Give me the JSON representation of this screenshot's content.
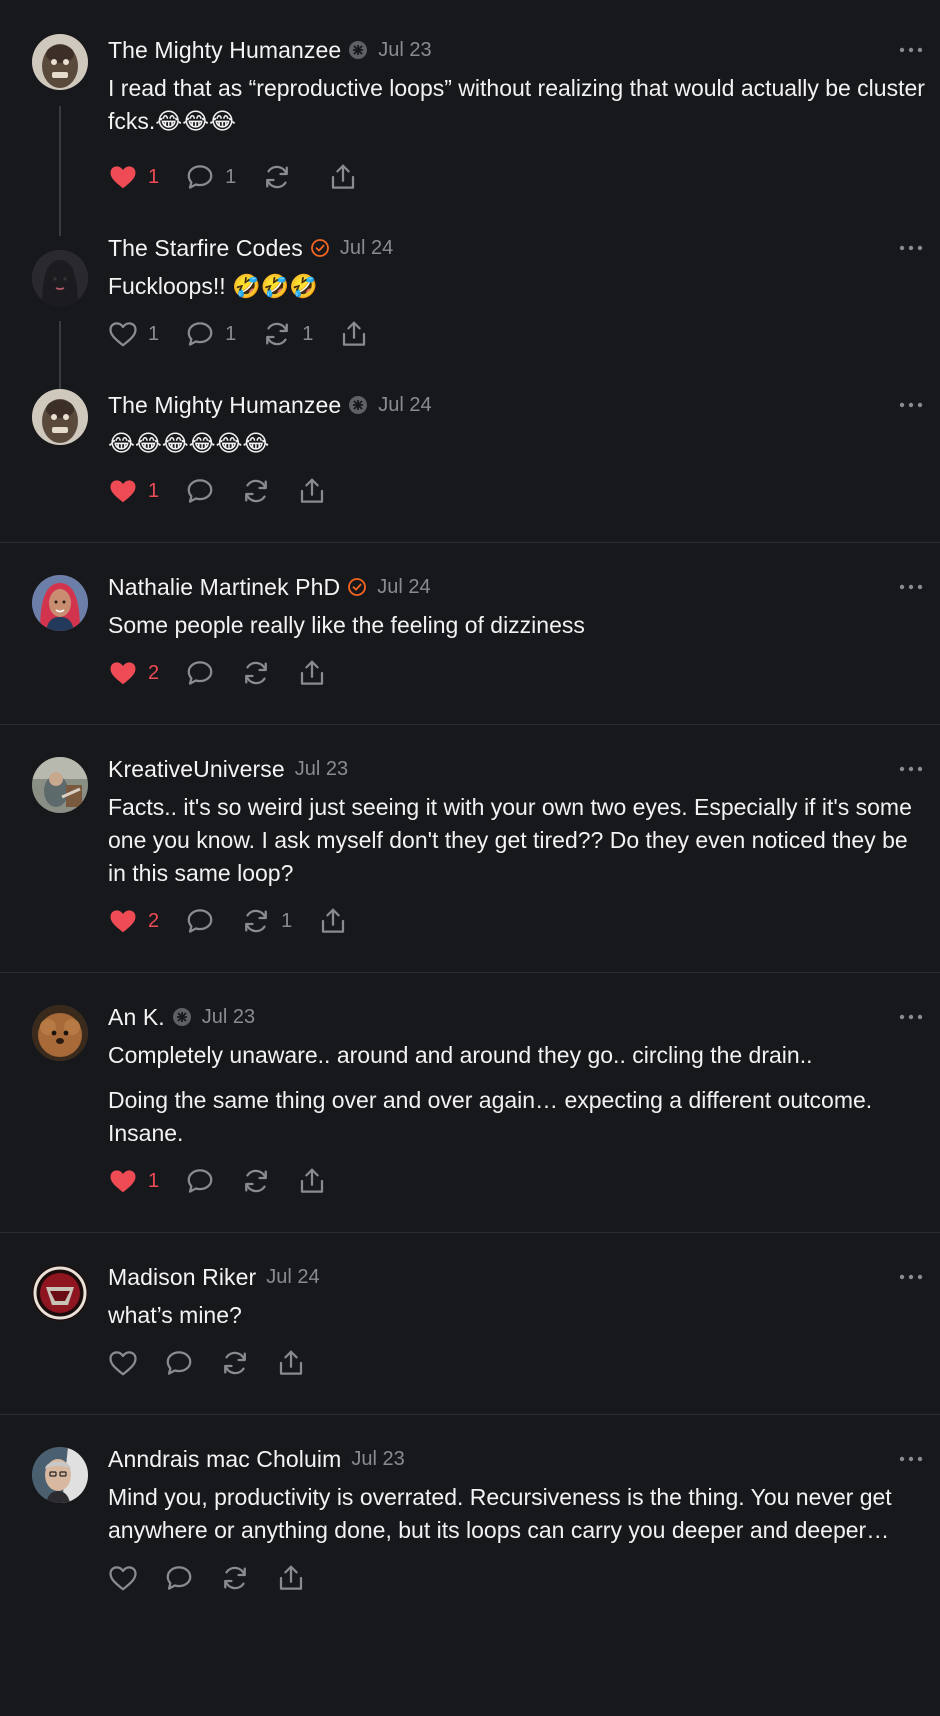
{
  "posts": [
    {
      "author": "The Mighty Humanzee",
      "badge": "grey-star-icon",
      "date": "Jul 23",
      "paragraphs": [
        "I read that as “reproductive loops” without realizing that would actually be cluster fcks.😂😂😂"
      ],
      "liked": true,
      "likes": "1",
      "replies": "1",
      "reposts": ""
    },
    {
      "author": "The Starfire Codes",
      "badge": "orange-check-icon",
      "date": "Jul 24",
      "paragraphs": [
        "Fuckloops!! 🤣🤣🤣"
      ],
      "liked": false,
      "likes": "1",
      "replies": "1",
      "reposts": "1"
    },
    {
      "author": "The Mighty Humanzee",
      "badge": "grey-star-icon",
      "date": "Jul 24",
      "paragraphs": [
        "😂😂😂😂😂😂"
      ],
      "liked": true,
      "likes": "1",
      "replies": "",
      "reposts": ""
    },
    {
      "author": "Nathalie Martinek PhD",
      "badge": "orange-check-icon",
      "date": "Jul 24",
      "paragraphs": [
        "Some people really like the feeling of dizziness"
      ],
      "liked": true,
      "likes": "2",
      "replies": "",
      "reposts": ""
    },
    {
      "author": "KreativeUniverse",
      "badge": "",
      "date": "Jul 23",
      "paragraphs": [
        "Facts.. it's so weird just seeing it with your own two eyes. Especially if it's some one you know. I ask myself don't they get tired?? Do they even noticed they be in this same loop?"
      ],
      "liked": true,
      "likes": "2",
      "replies": "",
      "reposts": "1"
    },
    {
      "author": "An K.",
      "badge": "grey-star-icon",
      "date": "Jul 23",
      "paragraphs": [
        "Completely unaware.. around and around they go.. circling the drain..",
        "Doing the same thing over and over again… expecting a different outcome. Insane."
      ],
      "liked": true,
      "likes": "1",
      "replies": "",
      "reposts": ""
    },
    {
      "author": "Madison Riker",
      "badge": "",
      "date": "Jul 24",
      "paragraphs": [
        "what’s mine?"
      ],
      "liked": false,
      "likes": "",
      "replies": "",
      "reposts": ""
    },
    {
      "author": "Anndrais mac Choluim",
      "badge": "",
      "date": "Jul 23",
      "paragraphs": [
        "Mind you, productivity is overrated. Recursiveness is the thing. You never get anywhere or anything done, but its loops can carry you deeper and deeper…"
      ],
      "liked": false,
      "likes": "",
      "replies": "",
      "reposts": ""
    }
  ],
  "icons": {
    "like": "heart-icon",
    "reply": "comment-icon",
    "repost": "repost-icon",
    "share": "share-icon",
    "more": "more-options-icon"
  },
  "colors": {
    "background": "#17181b",
    "like_active": "#ee4b55",
    "verified_check": "#f26522",
    "muted_text": "#8a8b90"
  }
}
